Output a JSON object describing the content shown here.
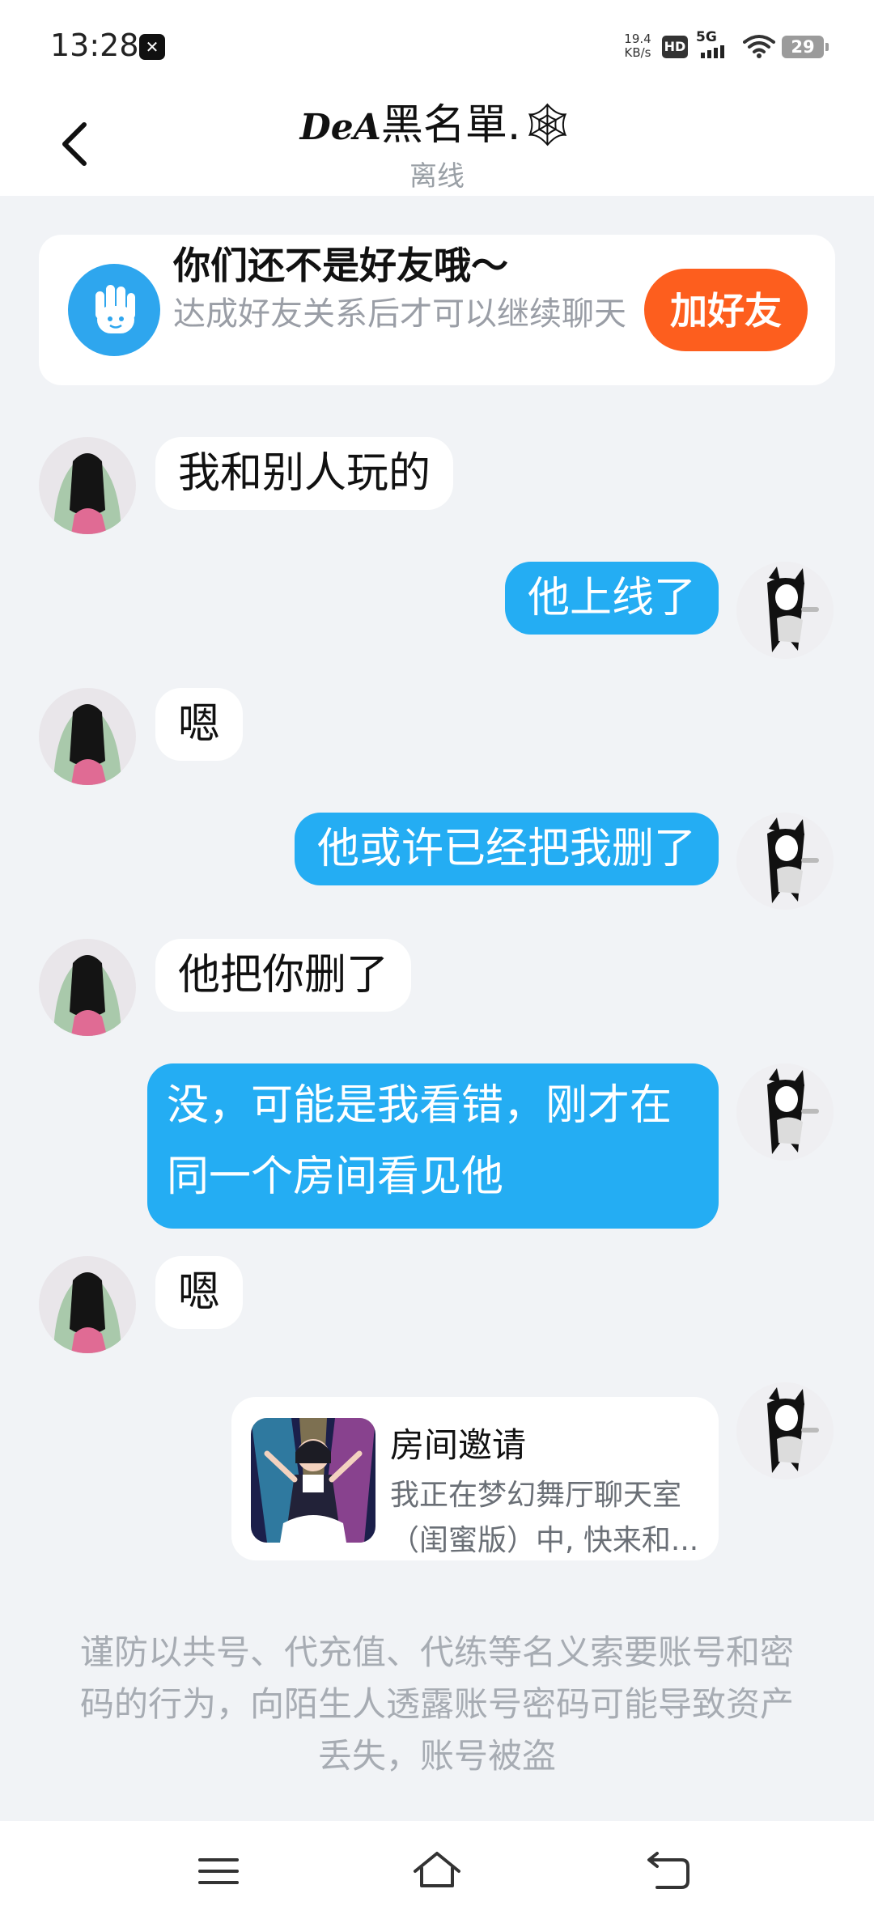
{
  "status_bar": {
    "time": "13:28",
    "net_speed_value": "19.4",
    "net_speed_unit": "KB/s",
    "hd": "HD",
    "network": "5G",
    "battery": "29"
  },
  "header": {
    "name_deco": "DeA",
    "name": "黑名單.🕸",
    "status": "离线"
  },
  "friend_card": {
    "title": "你们还不是好友哦～",
    "subtitle": "达成好友关系后才可以继续聊天",
    "add_button": "加好友"
  },
  "messages": [
    {
      "side": "in",
      "text": "我和别人玩的"
    },
    {
      "side": "out",
      "text": "他上线了"
    },
    {
      "side": "in",
      "text": "嗯"
    },
    {
      "side": "out",
      "text": "他或许已经把我删了"
    },
    {
      "side": "in",
      "text": "他把你删了"
    },
    {
      "side": "out",
      "text": "没，可能是我看错，刚才在同一个房间看见他"
    },
    {
      "side": "in",
      "text": "嗯"
    }
  ],
  "invite": {
    "title": "房间邀请",
    "desc_line1": "我正在梦幻舞厅聊天室",
    "desc_line2": "（闺蜜版）中, 快来和..."
  },
  "warning": "谨防以共号、代充值、代练等名义索要账号和密码的行为，向陌生人透露账号密码可能导致资产丢失，账号被盗",
  "colors": {
    "accent_blue": "#24adf3",
    "add_friend_orange": "#fd5e1e",
    "background": "#f1f3f6"
  }
}
